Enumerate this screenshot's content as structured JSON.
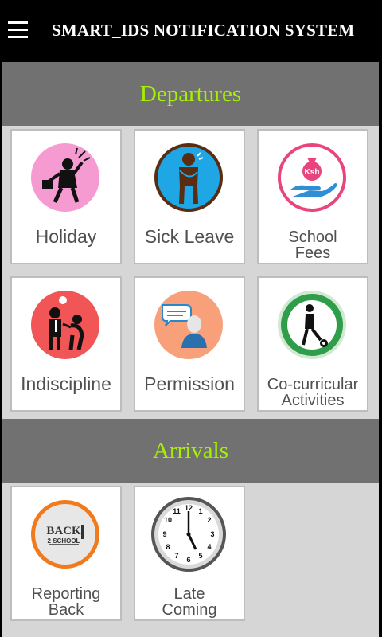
{
  "topbar": {
    "title": "SMART_IDS NOTIFICATION SYSTEM",
    "menu_icon": "hamburger-menu-icon"
  },
  "departures": {
    "header": "Departures",
    "tiles": [
      {
        "label": "Holiday",
        "icon": "holiday-icon"
      },
      {
        "label": "Sick Leave",
        "icon": "sick-leave-icon"
      },
      {
        "label_line1": "School",
        "label_line2": "Fees",
        "icon": "school-fees-icon",
        "badge": "Ksh"
      },
      {
        "label": "Indiscipline",
        "icon": "indiscipline-icon"
      },
      {
        "label": "Permission",
        "icon": "permission-icon"
      },
      {
        "label_line1": "Co-curricular",
        "label_line2": "Activities",
        "icon": "co-curricular-icon"
      }
    ]
  },
  "arrivals": {
    "header": "Arrivals",
    "tiles": [
      {
        "label_line1": "Reporting",
        "label_line2": "Back",
        "icon": "back-to-school-icon",
        "logo_text_1": "BACK",
        "logo_text_2": "2 SCHOOL"
      },
      {
        "label_line1": "Late",
        "label_line2": "Coming",
        "icon": "clock-icon"
      }
    ]
  },
  "colors": {
    "header_bg": "#717171",
    "header_text": "#a4f100",
    "topbar_bg": "#000000",
    "content_bg": "#d6d6d6"
  }
}
